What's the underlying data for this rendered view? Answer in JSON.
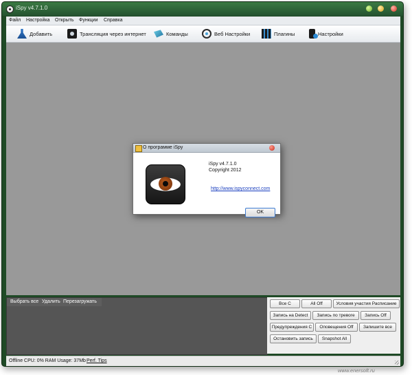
{
  "window": {
    "title": "iSpy v4.7.1.0"
  },
  "menu": [
    "Файл",
    "Настройка",
    "Открыть",
    "Функции",
    "Справка"
  ],
  "toolbar": [
    {
      "label": "Добавить",
      "icon": "add-flask-icon"
    },
    {
      "label": "Трансляция через интернет",
      "icon": "stream-icon"
    },
    {
      "label": "Команды",
      "icon": "commands-icon"
    },
    {
      "label": "Веб Настройки",
      "icon": "web-settings-icon"
    },
    {
      "label": "Плагины",
      "icon": "plugins-icon"
    },
    {
      "label": "Настройки",
      "icon": "settings-icon"
    }
  ],
  "dialog": {
    "title": "О программе iSpy",
    "version": "iSpy v4.7.1.0",
    "copyright": "Copyright 2012",
    "link": "http://www.ispyconnect.com",
    "ok": "OK"
  },
  "bottom_tabs": [
    "Выбрать все",
    "Удалить",
    "Перезагружать"
  ],
  "actions": [
    "Все С",
    "All Off",
    "Условия участия Расписание",
    "Запись на Detect",
    "Запись по тревоге",
    "Запись Off",
    "Предупреждения С",
    "Оповещения Off",
    "Запишите все",
    "Остановить запись",
    "Snapshot All"
  ],
  "status": {
    "text": "Offline  CPU: 0% RAM Usage: 37Mb",
    "link": "Perf. Tips"
  },
  "watermark": "www.enersoft.ru",
  "colors": {
    "title_bar": "#2e6236",
    "workspace": "#999999",
    "bottom_panel": "#555555"
  }
}
